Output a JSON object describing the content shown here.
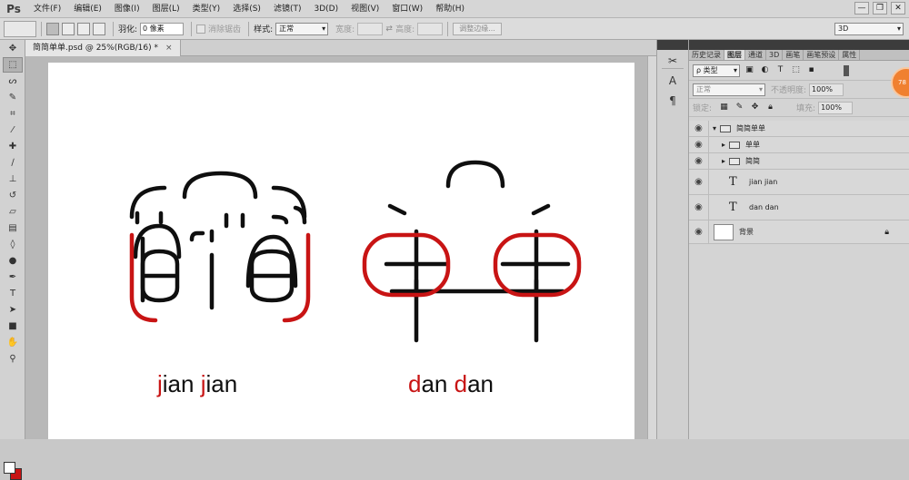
{
  "app": {
    "logo": "Ps"
  },
  "menu": [
    "文件(F)",
    "编辑(E)",
    "图像(I)",
    "图层(L)",
    "类型(Y)",
    "选择(S)",
    "滤镜(T)",
    "3D(D)",
    "视图(V)",
    "窗口(W)",
    "帮助(H)"
  ],
  "window_controls": {
    "minimize": "—",
    "restore": "❐",
    "close": "✕"
  },
  "options": {
    "feather_label": "羽化:",
    "feather_value": "0 像素",
    "antialias_label": "消除锯齿",
    "style_label": "样式:",
    "style_value": "正常",
    "width_label": "宽度:",
    "height_label": "高度:",
    "refine_edge_label": "调整边缘...",
    "workspace_value": "3D"
  },
  "document": {
    "tab_title": "简简单单.psd @ 25%(RGB/16) *",
    "tab_close": "×"
  },
  "artwork": {
    "left_caption": {
      "first_letter": "j",
      "rest": "ian",
      "second_first_letter": "j",
      "second_rest": "ian"
    },
    "right_caption": {
      "first_letter": "d",
      "rest": "an",
      "second_first_letter": "d",
      "second_rest": "an"
    }
  },
  "panel": {
    "tabs": [
      "历史记录",
      "图层",
      "通道",
      "3D",
      "画笔",
      "画笔预设",
      "属性"
    ],
    "active_tab": "图层",
    "filter_label": "ρ 类型",
    "blend_mode": "正常",
    "opacity_label": "不透明度:",
    "opacity_value": "100%",
    "lock_label": "锁定:",
    "fill_label": "填充:",
    "fill_value": "100%",
    "layers": [
      {
        "name": "简简单单",
        "kind": "group",
        "expanded": true
      },
      {
        "name": "单单",
        "kind": "group",
        "expanded": false
      },
      {
        "name": "简简",
        "kind": "group",
        "expanded": false
      },
      {
        "name": "jian jian",
        "kind": "text"
      },
      {
        "name": "dan dan",
        "kind": "text"
      },
      {
        "name": "背景",
        "kind": "background",
        "locked": true
      }
    ],
    "badge_text": "78"
  },
  "colors": {
    "accent_red": "#c81414",
    "ink_black": "#0f0f0f"
  }
}
